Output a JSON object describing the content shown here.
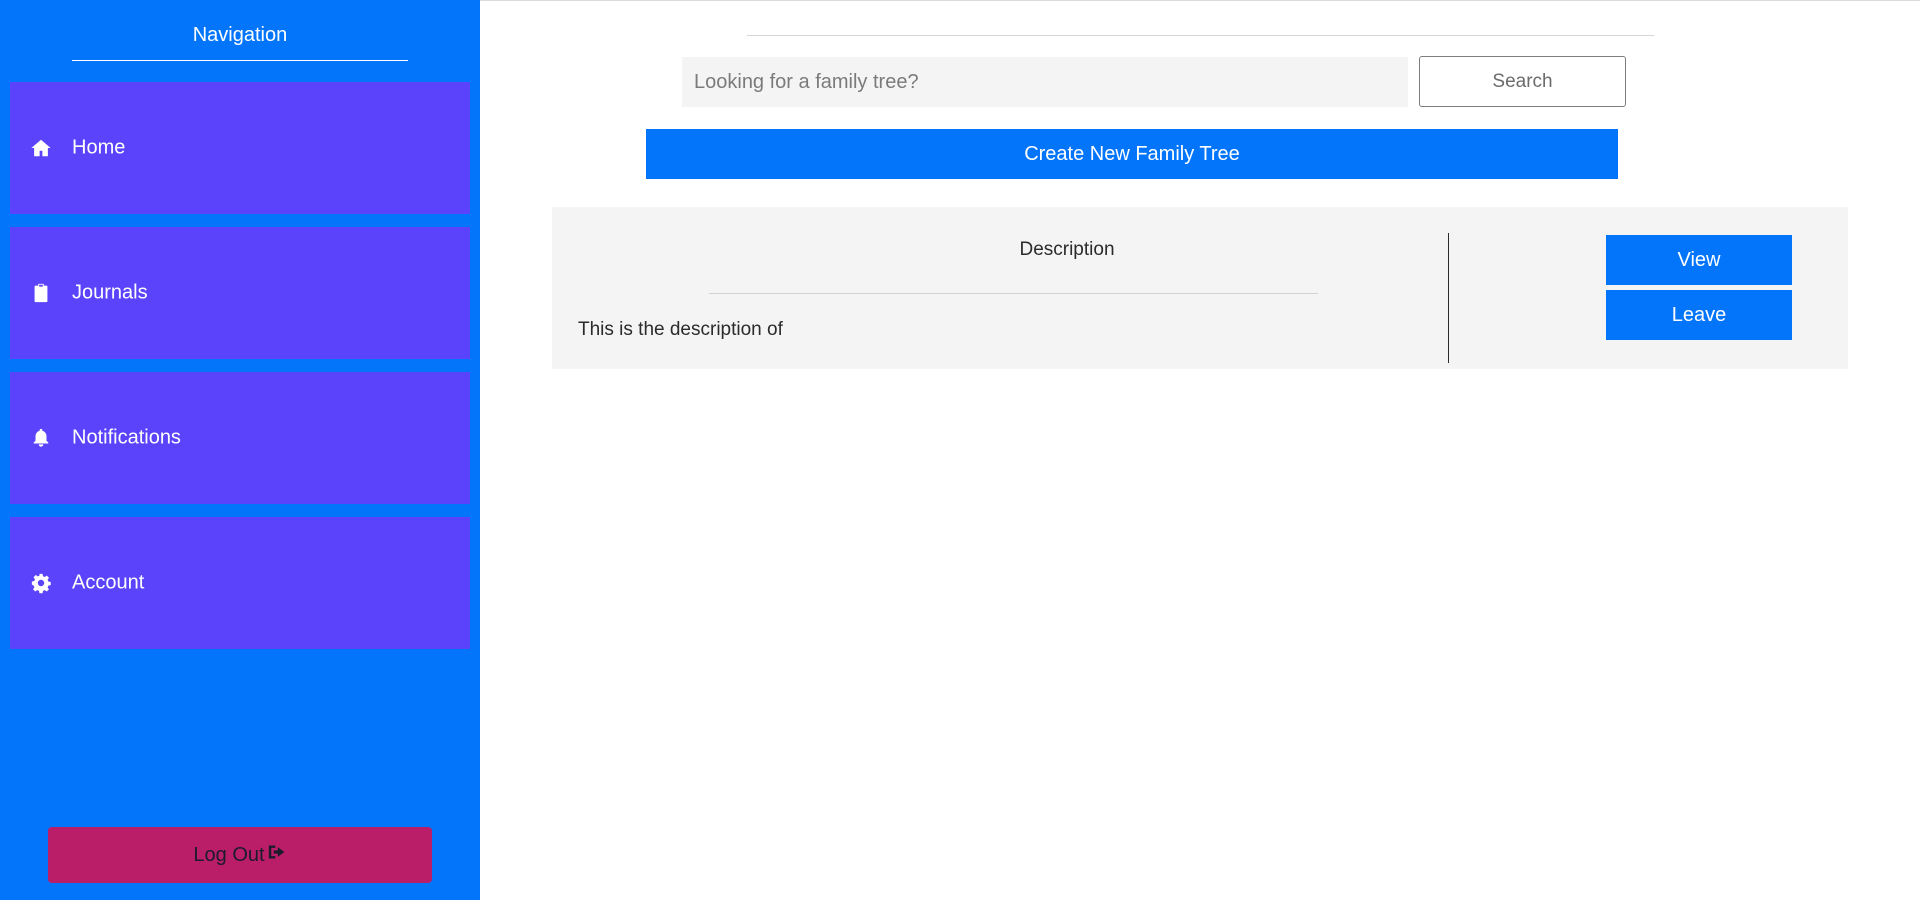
{
  "sidebar": {
    "title": "Navigation",
    "items": [
      {
        "label": "Home",
        "icon": "home-icon"
      },
      {
        "label": "Journals",
        "icon": "clipboard-icon"
      },
      {
        "label": "Notifications",
        "icon": "bell-icon"
      },
      {
        "label": "Account",
        "icon": "gear-icon"
      }
    ],
    "logout_label": "Log Out",
    "logout_icon": "sign-out-icon"
  },
  "search": {
    "placeholder": "Looking for a family tree?",
    "value": "",
    "button_label": "Search"
  },
  "create_button_label": "Create New Family Tree",
  "tree_card": {
    "heading": "Description",
    "description": "This is the description of",
    "view_label": "View",
    "leave_label": "Leave"
  },
  "colors": {
    "sidebar_bg": "#0275fb",
    "nav_item_bg": "#5b43fb",
    "primary_button": "#0275fb",
    "logout_bg": "#bb1e68",
    "card_bg": "#f4f4f4"
  }
}
